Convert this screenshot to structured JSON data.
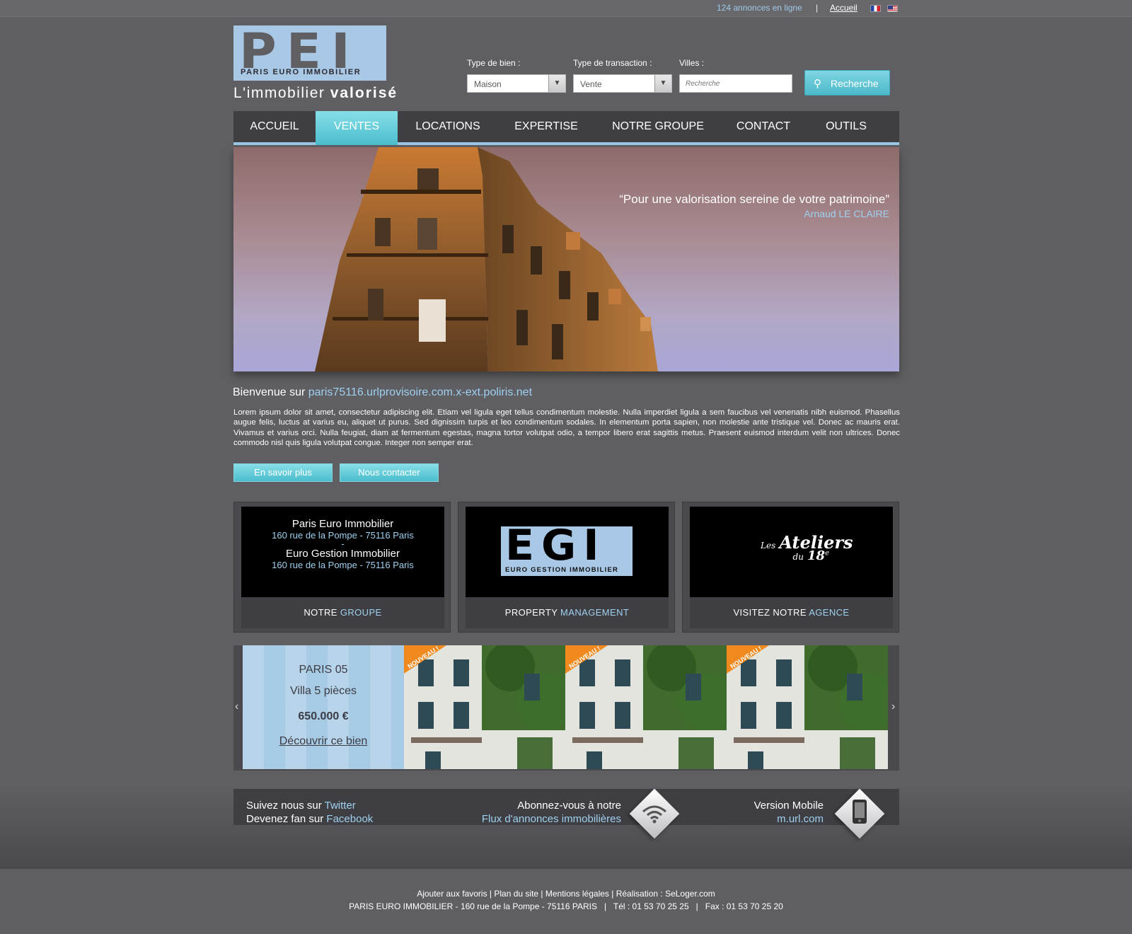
{
  "topbar": {
    "listings_count": "124 annonces en ligne",
    "separator": "|",
    "home_link": "Accueil"
  },
  "logo": {
    "letters": "PEI",
    "company": "PARIS EURO IMMOBILIER",
    "tagline_start": "L'immobilier ",
    "tagline_bold": "valorisé"
  },
  "search": {
    "property_type_label": "Type de bien :",
    "property_type_value": "Maison",
    "transaction_label": "Type de transaction :",
    "transaction_value": "Vente",
    "cities_label": "Villes :",
    "cities_placeholder": "Recherche",
    "button_label": "Recherche"
  },
  "nav": {
    "items": [
      "ACCUEIL",
      "VENTES",
      "LOCATIONS",
      "EXPERTISE",
      "NOTRE GROUPE",
      "CONTACT",
      "OUTILS"
    ],
    "active": "VENTES"
  },
  "hero": {
    "quote": "“Pour une valorisation sereine de votre patrimoine”",
    "author": "Arnaud LE CLAIRE"
  },
  "welcome": {
    "prefix": "Bienvenue sur ",
    "site": "paris75116.urlprovisoire.com.x-ext.poliris.net",
    "body": "Lorem ipsum dolor sit amet, consectetur adipiscing elit. Etiam vel ligula eget tellus condimentum molestie. Nulla imperdiet ligula a sem faucibus vel venenatis nibh euismod. Phasellus augue felis, luctus at varius eu, aliquet ut purus. Sed dignissim turpis et leo condimentum sodales. In elementum porta sapien, non molestie ante tristique vel. Donec ac mauris erat. Vivamus et varius orci. Nulla feugiat, diam at fermentum egestas, magna tortor volutpat odio, a tempor libero erat sagittis metus. Praesent euismod interdum velit non ultrices. Donec commodo nisl quis ligula volutpat congue. Integer non semper erat.",
    "btn_more": "En savoir plus",
    "btn_contact": "Nous contacter"
  },
  "boxes": {
    "group": {
      "name1": "Paris Euro Immobilier",
      "addr1": "160 rue de la Pompe - 75116 Paris",
      "dash": "-",
      "name2": "Euro Gestion Immobilier",
      "addr2": "160 rue de la Pompe - 75116 Paris",
      "foot_a": "NOTRE ",
      "foot_b": "GROUPE"
    },
    "egi": {
      "letters": "EGI",
      "sub": "EURO GESTION IMMOBILIER",
      "foot_a": "PROPERTY ",
      "foot_b": "MANAGEMENT"
    },
    "ateliers": {
      "les": "Les",
      "name": "Ateliers",
      "du": "du",
      "num": "18",
      "sup": "e",
      "foot_a": "VISITEZ NOTRE ",
      "foot_b": "AGENCE"
    }
  },
  "carousel": {
    "city": "PARIS 05",
    "type": "Villa 5 pièces",
    "price": "650.000 €",
    "cta": "Découvrir ce bien",
    "badge": "NOUVEAU !",
    "prev": "‹",
    "next": "›"
  },
  "social": {
    "follow_prefix": "Suivez nous sur ",
    "follow_link": "Twitter",
    "fan_prefix": "Devenez fan sur ",
    "fan_link": "Facebook",
    "rss_line1": "Abonnez-vous à notre",
    "rss_line2": "Flux d'annonces immobilières",
    "mobile_line1": "Version Mobile",
    "mobile_line2": "m.url.com"
  },
  "footer": {
    "links": "Ajouter aux favoris | Plan du site | Mentions légales | Réalisation : SeLoger.com",
    "address": "PARIS EURO IMMOBILIER - 160 rue de la Pompe - 75116 PARIS   |   Tél : 01 53 70 25 25   |   Fax : 01 53 70 25 20"
  },
  "colors": {
    "background": "#5f5e62",
    "accent_cyan": "#4bbccc",
    "accent_blue": "#9fd1f0",
    "nav_bg": "#3f3e43"
  }
}
